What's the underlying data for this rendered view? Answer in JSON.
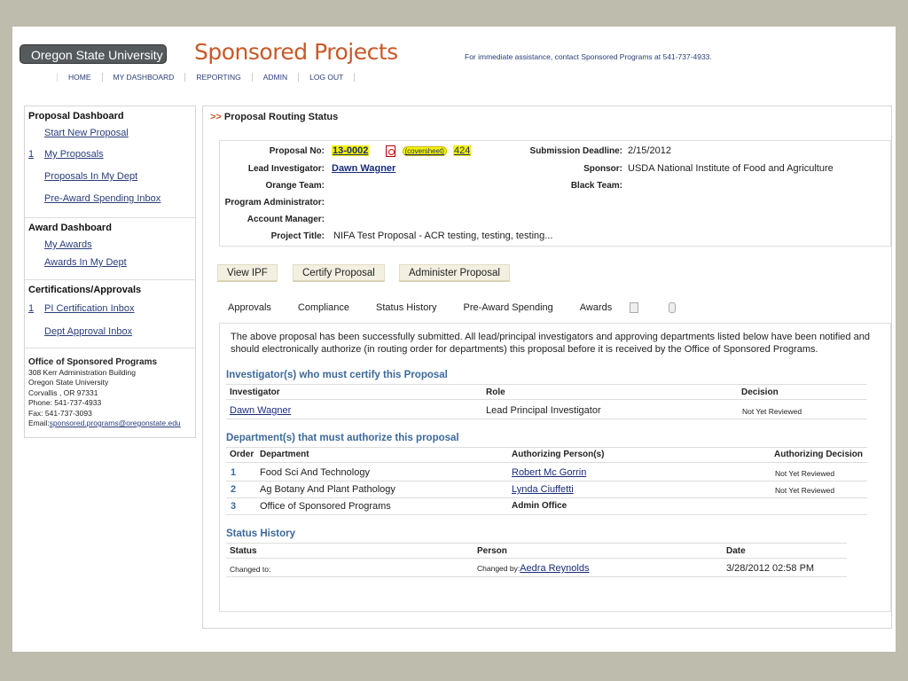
{
  "header": {
    "university": "Oregon State University",
    "title": "Sponsored Projects",
    "contact": "For immediate assistance, contact Sponsored Programs at 541-737-4933.",
    "nav": [
      "HOME",
      "MY DASHBOARD",
      "REPORTING",
      "ADMIN",
      "LOG OUT"
    ]
  },
  "sidebar": {
    "proposal_dashboard": "Proposal Dashboard",
    "start_new": "Start New Proposal",
    "my_proposals_count": "1",
    "my_proposals": "My Proposals",
    "proposals_in_dept": "Proposals In My Dept",
    "pre_award_inbox": "Pre-Award Spending Inbox",
    "award_dashboard": "Award Dashboard",
    "my_awards": "My Awards",
    "awards_in_dept": "Awards In My Dept",
    "certs": "Certifications/Approvals",
    "pi_cert_count": "1",
    "pi_cert": "PI Certification Inbox",
    "dept_approval": "Dept Approval Inbox",
    "ops_title": "Office of Sponsored Programs",
    "ops_addr1": "308 Kerr Administration Building",
    "ops_addr2": "Oregon State University",
    "ops_addr3": "Corvallis , OR 97331",
    "ops_phone": "Phone: 541-737-4933",
    "ops_fax": "Fax: 541-737-3093",
    "ops_email_label": "Email:",
    "ops_email": "sponsored.programs@oregonstate.edu"
  },
  "main": {
    "crumb_arrow": ">>",
    "crumb": "Proposal Routing Status",
    "labels": {
      "proposal_no": "Proposal No:",
      "lead": "Lead Investigator:",
      "orange": "Orange Team:",
      "prog_admin": "Program Administrator:",
      "acct_mgr": "Account Manager:",
      "project_title": "Project Title:",
      "deadline": "Submission Deadline:",
      "sponsor": "Sponsor:",
      "black": "Black Team:"
    },
    "values": {
      "proposal_no": "13-0002",
      "coversheet": "(coversheet)",
      "count": "424",
      "lead": "Dawn Wagner",
      "project_title": "NIFA Test Proposal - ACR testing, testing, testing...",
      "deadline": "2/15/2012",
      "sponsor": "USDA National Institute of Food and Agriculture"
    },
    "buttons": [
      "View IPF",
      "Certify Proposal",
      "Administer Proposal"
    ],
    "tabs": [
      "Approvals",
      "Compliance",
      "Status History",
      "Pre-Award Spending",
      "Awards"
    ],
    "notice": "The above proposal has been successfully submitted. All lead/principal investigators and approving departments listed below have been notified and should electronically authorize (in routing order for departments) this proposal before it is received by the Office of Sponsored Programs.",
    "investigators": {
      "title": "Investigator(s) who must certify this Proposal",
      "headers": [
        "Investigator",
        "Role",
        "Decision"
      ],
      "rows": [
        {
          "name": "Dawn Wagner",
          "role": "Lead Principal Investigator",
          "decision": "Not Yet Reviewed"
        }
      ]
    },
    "departments": {
      "title": "Department(s) that must authorize this proposal",
      "headers": [
        "Order",
        "Department",
        "Authorizing Person(s)",
        "Authorizing Decision"
      ],
      "rows": [
        {
          "order": "1",
          "dept": "Food Sci And Technology",
          "person": "Robert Mc Gorrin",
          "decision": "Not Yet Reviewed"
        },
        {
          "order": "2",
          "dept": "Ag Botany And Plant Pathology",
          "person": "Lynda Ciuffetti",
          "decision": "Not Yet Reviewed"
        },
        {
          "order": "3",
          "dept": "Office of Sponsored Programs",
          "person": "Admin Office",
          "decision": ""
        }
      ]
    },
    "status_history": {
      "title": "Status History",
      "headers": [
        "Status",
        "Person",
        "Date"
      ],
      "changed_to": "Changed to:",
      "changed_by": "Changed by:",
      "person": "Aedra Reynolds",
      "date": "3/28/2012 02:58 PM"
    }
  }
}
